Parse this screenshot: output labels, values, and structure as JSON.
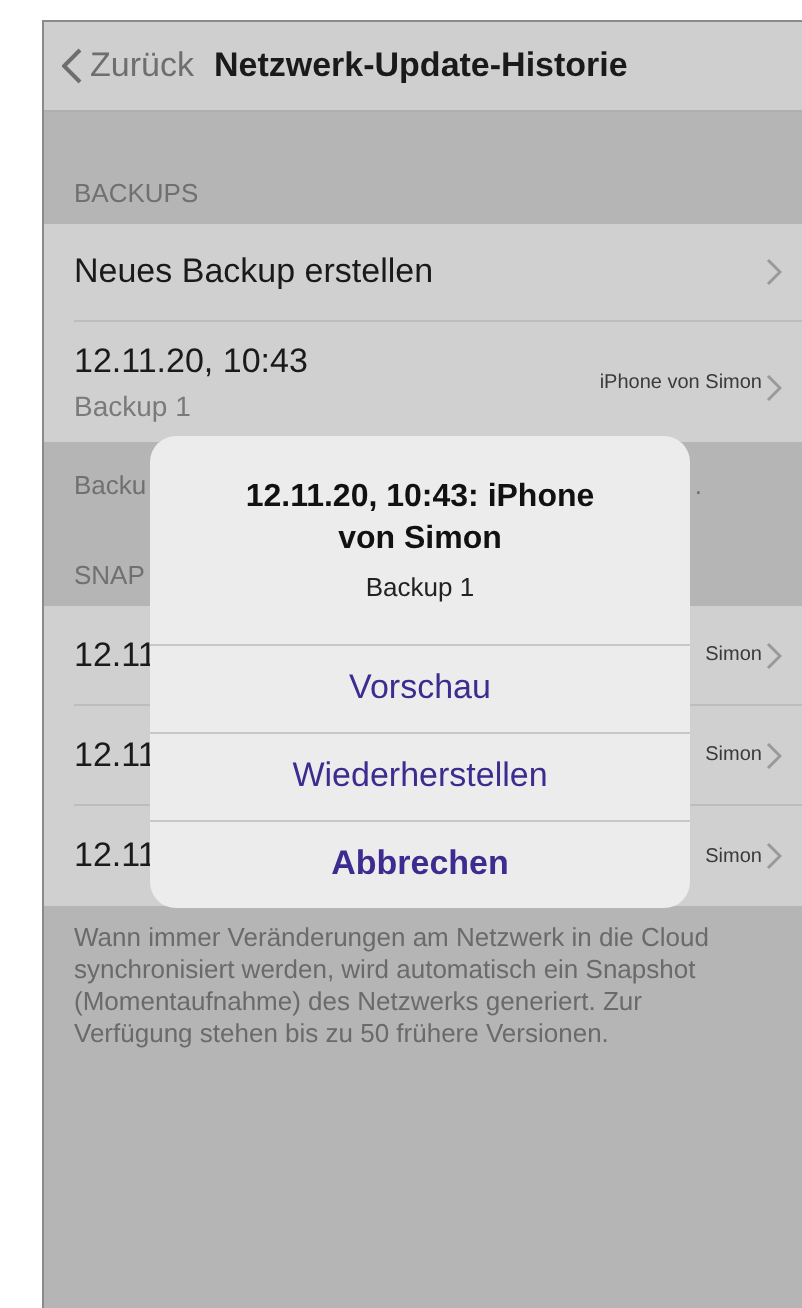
{
  "nav": {
    "back": "Zurück",
    "title": "Netzwerk-Update-Historie"
  },
  "backups": {
    "header": "BACKUPS",
    "rows": [
      {
        "kind": "action",
        "title": "Neues Backup erstellen"
      },
      {
        "kind": "entry",
        "title": "12.11.20, 10:43",
        "subtitle": "Backup 1",
        "detail": "iPhone von Simon"
      }
    ],
    "footer_left": "Backu",
    "footer_right": "."
  },
  "snapshots": {
    "header": "SNAP",
    "rows": [
      {
        "title": "12.11",
        "detail": "Simon"
      },
      {
        "title": "12.11",
        "detail": "Simon"
      },
      {
        "title": "12.11",
        "detail": "Simon"
      }
    ],
    "footer": "Wann immer Veränderungen am Netzwerk in die Cloud synchronisiert werden, wird automatisch ein Snapshot (Momentaufnahme) des Netzwerks generiert. Zur Verfügung stehen bis zu 50 frühere Versionen."
  },
  "alert": {
    "title": "12.11.20, 10:43: iPhone von Simon",
    "message": "Backup 1",
    "actions": [
      {
        "label": "Vorschau",
        "kind": "default"
      },
      {
        "label": "Wiederherstellen",
        "kind": "default"
      },
      {
        "label": "Abbrechen",
        "kind": "cancel"
      }
    ]
  }
}
